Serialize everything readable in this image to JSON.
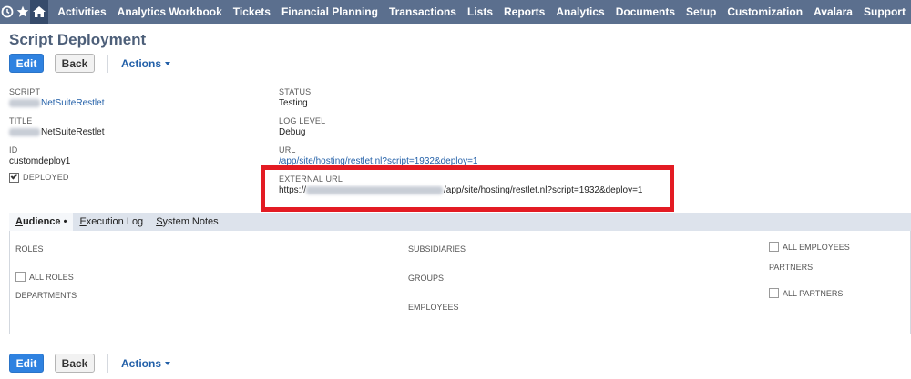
{
  "nav": {
    "items": [
      "Activities",
      "Analytics Workbook",
      "Tickets",
      "Financial Planning",
      "Transactions",
      "Lists",
      "Reports",
      "Analytics",
      "Documents",
      "Setup",
      "Customization",
      "Avalara",
      "Support"
    ]
  },
  "page": {
    "title": "Script Deployment",
    "edit_label": "Edit",
    "back_label": "Back",
    "actions_label": "Actions"
  },
  "fields": {
    "script_label": "SCRIPT",
    "script_value": "NetSuiteRestlet",
    "title_label": "TITLE",
    "title_value": "NetSuiteRestlet",
    "id_label": "ID",
    "id_value": "customdeploy1",
    "deployed_label": "DEPLOYED",
    "deployed_checked": true,
    "status_label": "STATUS",
    "status_value": "Testing",
    "log_level_label": "LOG LEVEL",
    "log_level_value": "Debug",
    "url_label": "URL",
    "url_value": "/app/site/hosting/restlet.nl?script=1932&deploy=1",
    "external_url_label": "EXTERNAL URL",
    "external_url_prefix": "https://",
    "external_url_suffix": "/app/site/hosting/restlet.nl?script=1932&deploy=1"
  },
  "tabs": [
    {
      "key": "A",
      "rest": "udience",
      "marker": " •"
    },
    {
      "key": "E",
      "rest": "xecution Log",
      "marker": ""
    },
    {
      "key": "S",
      "rest": "ystem Notes",
      "marker": ""
    }
  ],
  "audience": {
    "roles_label": "ROLES",
    "all_roles_label": "ALL ROLES",
    "departments_label": "DEPARTMENTS",
    "subsidiaries_label": "SUBSIDIARIES",
    "groups_label": "GROUPS",
    "employees_label": "EMPLOYEES",
    "all_employees_label": "ALL EMPLOYEES",
    "partners_label": "PARTNERS",
    "all_partners_label": "ALL PARTNERS"
  },
  "colors": {
    "nav_bg": "#5b6f8e",
    "highlight": "#e31b23",
    "primary_button": "#2f82e0",
    "link": "#2360a8"
  }
}
